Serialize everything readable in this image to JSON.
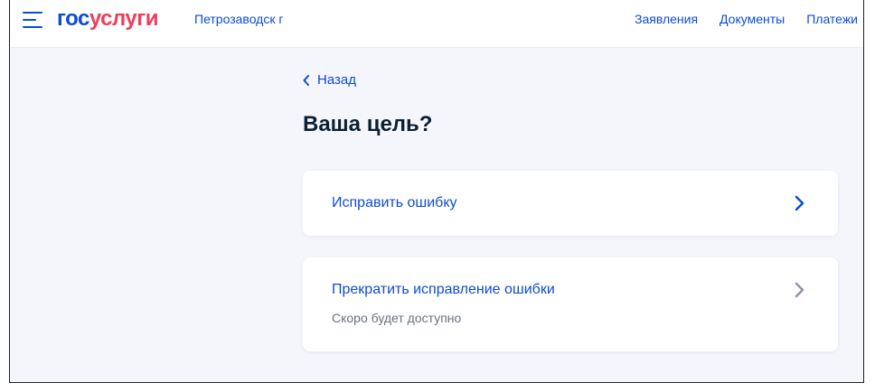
{
  "header": {
    "logo_part1": "гос",
    "logo_part2": "услуги",
    "city": "Петрозаводск г",
    "nav": [
      "Заявления",
      "Документы",
      "Платежи"
    ]
  },
  "main": {
    "back_label": "Назад",
    "title": "Ваша цель?",
    "options": [
      {
        "label": "Исправить ошибку",
        "sublabel": ""
      },
      {
        "label": "Прекратить исправление ошибки",
        "sublabel": "Скоро будет доступно"
      }
    ]
  },
  "colors": {
    "brand_blue": "#0d4cd3",
    "brand_red": "#ee3f58",
    "background": "#f4f6fb",
    "disabled_chevron": "#8c97a5"
  },
  "icons": {
    "menu": "menu-icon",
    "back": "chevron-left-icon",
    "option_arrow": "chevron-right-icon"
  }
}
